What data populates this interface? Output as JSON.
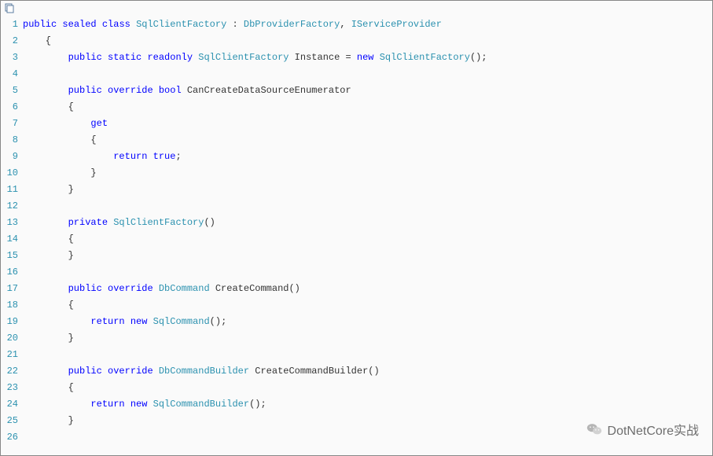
{
  "toolbar": {
    "copy_icon_label": "copy"
  },
  "watermark": {
    "text": "DotNetCore实战"
  },
  "code": {
    "lines": [
      {
        "n": 1,
        "tokens": [
          [
            "kw",
            "public"
          ],
          [
            "plain",
            " "
          ],
          [
            "kw",
            "sealed"
          ],
          [
            "plain",
            " "
          ],
          [
            "kw",
            "class"
          ],
          [
            "plain",
            " "
          ],
          [
            "type",
            "SqlClientFactory"
          ],
          [
            "plain",
            " : "
          ],
          [
            "type",
            "DbProviderFactory"
          ],
          [
            "plain",
            ", "
          ],
          [
            "type",
            "IServiceProvider"
          ]
        ]
      },
      {
        "n": 2,
        "tokens": [
          [
            "plain",
            "    {"
          ]
        ]
      },
      {
        "n": 3,
        "tokens": [
          [
            "plain",
            "        "
          ],
          [
            "kw",
            "public"
          ],
          [
            "plain",
            " "
          ],
          [
            "kw",
            "static"
          ],
          [
            "plain",
            " "
          ],
          [
            "kw",
            "readonly"
          ],
          [
            "plain",
            " "
          ],
          [
            "type",
            "SqlClientFactory"
          ],
          [
            "plain",
            " Instance = "
          ],
          [
            "kw",
            "new"
          ],
          [
            "plain",
            " "
          ],
          [
            "type",
            "SqlClientFactory"
          ],
          [
            "plain",
            "();"
          ]
        ]
      },
      {
        "n": 4,
        "tokens": []
      },
      {
        "n": 5,
        "tokens": [
          [
            "plain",
            "        "
          ],
          [
            "kw",
            "public"
          ],
          [
            "plain",
            " "
          ],
          [
            "kw",
            "override"
          ],
          [
            "plain",
            " "
          ],
          [
            "kw",
            "bool"
          ],
          [
            "plain",
            " CanCreateDataSourceEnumerator"
          ]
        ]
      },
      {
        "n": 6,
        "tokens": [
          [
            "plain",
            "        {"
          ]
        ]
      },
      {
        "n": 7,
        "tokens": [
          [
            "plain",
            "            "
          ],
          [
            "kw",
            "get"
          ]
        ]
      },
      {
        "n": 8,
        "tokens": [
          [
            "plain",
            "            {"
          ]
        ]
      },
      {
        "n": 9,
        "tokens": [
          [
            "plain",
            "                "
          ],
          [
            "kw",
            "return"
          ],
          [
            "plain",
            " "
          ],
          [
            "kw",
            "true"
          ],
          [
            "plain",
            ";"
          ]
        ]
      },
      {
        "n": 10,
        "tokens": [
          [
            "plain",
            "            }"
          ]
        ]
      },
      {
        "n": 11,
        "tokens": [
          [
            "plain",
            "        }"
          ]
        ]
      },
      {
        "n": 12,
        "tokens": []
      },
      {
        "n": 13,
        "tokens": [
          [
            "plain",
            "        "
          ],
          [
            "kw",
            "private"
          ],
          [
            "plain",
            " "
          ],
          [
            "type",
            "SqlClientFactory"
          ],
          [
            "plain",
            "()"
          ]
        ]
      },
      {
        "n": 14,
        "tokens": [
          [
            "plain",
            "        {"
          ]
        ]
      },
      {
        "n": 15,
        "tokens": [
          [
            "plain",
            "        }"
          ]
        ]
      },
      {
        "n": 16,
        "tokens": []
      },
      {
        "n": 17,
        "tokens": [
          [
            "plain",
            "        "
          ],
          [
            "kw",
            "public"
          ],
          [
            "plain",
            " "
          ],
          [
            "kw",
            "override"
          ],
          [
            "plain",
            " "
          ],
          [
            "type",
            "DbCommand"
          ],
          [
            "plain",
            " CreateCommand()"
          ]
        ]
      },
      {
        "n": 18,
        "tokens": [
          [
            "plain",
            "        {"
          ]
        ]
      },
      {
        "n": 19,
        "tokens": [
          [
            "plain",
            "            "
          ],
          [
            "kw",
            "return"
          ],
          [
            "plain",
            " "
          ],
          [
            "kw",
            "new"
          ],
          [
            "plain",
            " "
          ],
          [
            "type",
            "SqlCommand"
          ],
          [
            "plain",
            "();"
          ]
        ]
      },
      {
        "n": 20,
        "tokens": [
          [
            "plain",
            "        }"
          ]
        ]
      },
      {
        "n": 21,
        "tokens": []
      },
      {
        "n": 22,
        "tokens": [
          [
            "plain",
            "        "
          ],
          [
            "kw",
            "public"
          ],
          [
            "plain",
            " "
          ],
          [
            "kw",
            "override"
          ],
          [
            "plain",
            " "
          ],
          [
            "type",
            "DbCommandBuilder"
          ],
          [
            "plain",
            " CreateCommandBuilder()"
          ]
        ]
      },
      {
        "n": 23,
        "tokens": [
          [
            "plain",
            "        {"
          ]
        ]
      },
      {
        "n": 24,
        "tokens": [
          [
            "plain",
            "            "
          ],
          [
            "kw",
            "return"
          ],
          [
            "plain",
            " "
          ],
          [
            "kw",
            "new"
          ],
          [
            "plain",
            " "
          ],
          [
            "type",
            "SqlCommandBuilder"
          ],
          [
            "plain",
            "();"
          ]
        ]
      },
      {
        "n": 25,
        "tokens": [
          [
            "plain",
            "        }"
          ]
        ]
      },
      {
        "n": 26,
        "tokens": []
      }
    ]
  }
}
